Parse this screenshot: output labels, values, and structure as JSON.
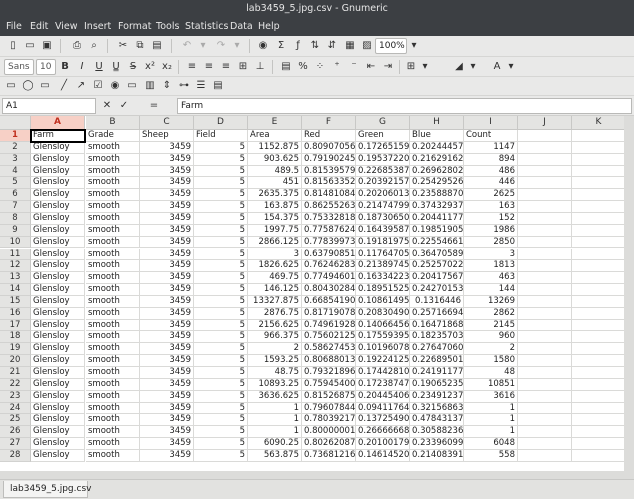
{
  "window": {
    "title": "lab3459_5.jpg.csv - Gnumeric"
  },
  "menu": [
    "File",
    "Edit",
    "View",
    "Insert",
    "Format",
    "Tools",
    "Statistics",
    "Data",
    "Help"
  ],
  "toolbar": {
    "zoom": "100%",
    "font_name": "Sans",
    "font_size": "10"
  },
  "formula_bar": {
    "cell_ref": "A1",
    "content": "Farm"
  },
  "columns": [
    "A",
    "B",
    "C",
    "D",
    "E",
    "F",
    "G",
    "H",
    "I",
    "J",
    "K"
  ],
  "rows": [
    [
      "Farm",
      "Grade",
      "Sheep",
      "Field",
      "Area",
      "Red",
      "Green",
      "Blue",
      "Count"
    ],
    [
      "Glensloy",
      "smooth",
      "3459",
      "5",
      "1152.875",
      "0.809070562",
      "0.172651594",
      "0.202444576",
      "1147"
    ],
    [
      "Glensloy",
      "smooth",
      "3459",
      "5",
      "903.625",
      "0.791902456",
      "0.195372203",
      "0.216291623",
      "894"
    ],
    [
      "Glensloy",
      "smooth",
      "3459",
      "5",
      "489.5",
      "0.815395799",
      "0.226853874",
      "0.269628024",
      "486"
    ],
    [
      "Glensloy",
      "smooth",
      "3459",
      "5",
      "451",
      "0.815633529",
      "0.203921572",
      "0.254295269",
      "446"
    ],
    [
      "Glensloy",
      "smooth",
      "3459",
      "5",
      "2635.375",
      "0.814810842",
      "0.202060136",
      "0.235888708",
      "2625"
    ],
    [
      "Glensloy",
      "smooth",
      "3459",
      "5",
      "163.875",
      "0.862552637",
      "0.214747991",
      "0.374329373",
      "163"
    ],
    [
      "Glensloy",
      "smooth",
      "3459",
      "5",
      "154.375",
      "0.753328188",
      "0.187306507",
      "0.204411771",
      "152"
    ],
    [
      "Glensloy",
      "smooth",
      "3459",
      "5",
      "1997.75",
      "0.775876245",
      "0.164395874",
      "0.19851905",
      "1986"
    ],
    [
      "Glensloy",
      "smooth",
      "3459",
      "5",
      "2866.125",
      "0.778399738",
      "0.191819751",
      "0.225546617",
      "2850"
    ],
    [
      "Glensloy",
      "smooth",
      "3459",
      "5",
      "3",
      "0.637908518",
      "0.117647059",
      "0.36470589",
      "3"
    ],
    [
      "Glensloy",
      "smooth",
      "3459",
      "5",
      "1826.625",
      "0.762462837",
      "0.213897457",
      "0.252570224",
      "1813"
    ],
    [
      "Glensloy",
      "smooth",
      "3459",
      "5",
      "469.75",
      "0.774946018",
      "0.163342231",
      "0.20417567",
      "463"
    ],
    [
      "Glensloy",
      "smooth",
      "3459",
      "5",
      "146.125",
      "0.804302844",
      "0.189515255",
      "0.242701531",
      "144"
    ],
    [
      "Glensloy",
      "smooth",
      "3459",
      "5",
      "13327.875",
      "0.668541909",
      "0.108614953",
      "0.1316446",
      "13269"
    ],
    [
      "Glensloy",
      "smooth",
      "3459",
      "5",
      "2876.75",
      "0.817190787",
      "0.208304907",
      "0.25716694",
      "2862"
    ],
    [
      "Glensloy",
      "smooth",
      "3459",
      "5",
      "2156.625",
      "0.749619285",
      "0.140664568",
      "0.164718685",
      "2145"
    ],
    [
      "Glensloy",
      "smooth",
      "3459",
      "5",
      "966.375",
      "0.756021256",
      "0.175593959",
      "0.182357031",
      "960"
    ],
    [
      "Glensloy",
      "smooth",
      "3459",
      "5",
      "2",
      "0.586274534",
      "0.101960786",
      "0.276470602",
      "2"
    ],
    [
      "Glensloy",
      "smooth",
      "3459",
      "5",
      "1593.25",
      "0.806880131",
      "0.192241255",
      "0.226895017",
      "1580"
    ],
    [
      "Glensloy",
      "smooth",
      "3459",
      "5",
      "48.75",
      "0.793218967",
      "0.174428109",
      "0.241911771",
      "48"
    ],
    [
      "Glensloy",
      "smooth",
      "3459",
      "5",
      "10893.25",
      "0.759454008",
      "0.172387478",
      "0.190652353",
      "10851"
    ],
    [
      "Glensloy",
      "smooth",
      "3459",
      "5",
      "3636.625",
      "0.815268751",
      "0.204454066",
      "0.234912379",
      "3616"
    ],
    [
      "Glensloy",
      "smooth",
      "3459",
      "5",
      "1",
      "0.796078444",
      "0.094117649",
      "0.321568638",
      "1"
    ],
    [
      "Glensloy",
      "smooth",
      "3459",
      "5",
      "1",
      "0.78039217",
      "0.137254909",
      "0.478431374",
      "1"
    ],
    [
      "Glensloy",
      "smooth",
      "3459",
      "5",
      "1",
      "0.800000012",
      "0.266666681",
      "0.305882365",
      "1"
    ],
    [
      "Glensloy",
      "smooth",
      "3459",
      "5",
      "6090.25",
      "0.802620875",
      "0.201001796",
      "0.233960998",
      "6048"
    ],
    [
      "Glensloy",
      "smooth",
      "3459",
      "5",
      "563.875",
      "0.73681216",
      "0.146145201",
      "0.214083919",
      "558"
    ]
  ],
  "sheet_tab": "lab3459_5.jpg.csv"
}
